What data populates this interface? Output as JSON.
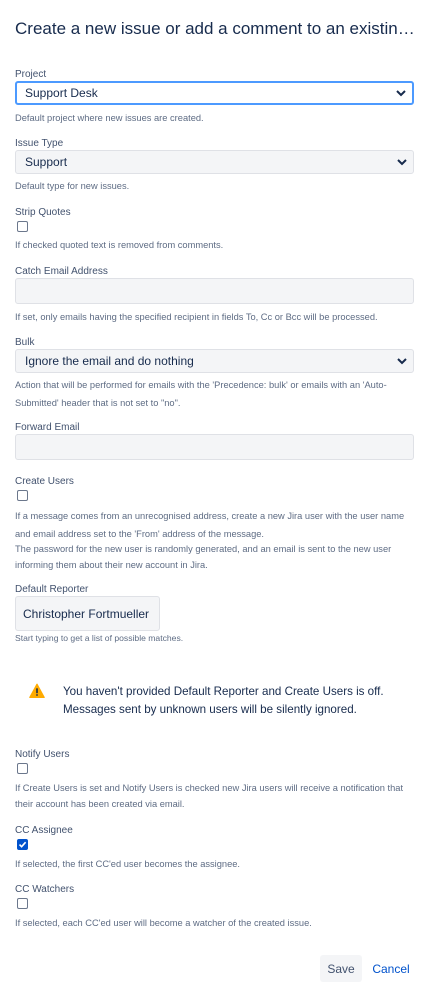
{
  "title": "Create a new issue or add a comment to an existing iss...",
  "project": {
    "label": "Project",
    "value": "Support Desk",
    "description": "Default project where new issues are created."
  },
  "issue_type": {
    "label": "Issue Type",
    "value": "Support",
    "description": "Default type for new issues."
  },
  "strip_quotes": {
    "label": "Strip Quotes",
    "checked": false,
    "description": "If checked quoted text is removed from comments."
  },
  "catch_email": {
    "label": "Catch Email Address",
    "value": "",
    "description": "If set, only emails having the specified recipient in fields To, Cc or Bcc will be processed."
  },
  "bulk": {
    "label": "Bulk",
    "value": "Ignore the email and do nothing",
    "description_line1": "Action that will be performed for emails with the 'Precedence: bulk' or emails with an 'Auto-",
    "description_line2": "Submitted' header that is not set to \"no\"."
  },
  "forward_email": {
    "label": "Forward Email",
    "value": ""
  },
  "create_users": {
    "label": "Create Users",
    "checked": false,
    "description_line1": "If a message comes from an unrecognised address, create a new Jira user with the user name",
    "description_line2": "and email address set to the 'From' address of the message.",
    "description_line3": "The password for the new user is randomly generated, and an email is sent to the new user",
    "description_line4": "informing them about their new account in Jira."
  },
  "default_reporter": {
    "label": "Default Reporter",
    "value": "Christopher Fortmueller",
    "hint": "Start typing to get a list of possible matches."
  },
  "warning": {
    "line1": "You haven't provided Default Reporter and Create Users is off.",
    "line2": "Messages sent by unknown users will be silently ignored.",
    "icon_color": "#ffab00"
  },
  "notify_users": {
    "label": "Notify Users",
    "checked": false,
    "description_line1": "If Create Users is set and Notify Users is checked new Jira users will receive a notification that",
    "description_line2": "their account has been created via email."
  },
  "cc_assignee": {
    "label": "CC Assignee",
    "checked": true,
    "description": "If selected, the first CC'ed user becomes the assignee."
  },
  "cc_watchers": {
    "label": "CC Watchers",
    "checked": false,
    "description": "If selected, each CC'ed user will become a watcher of the created issue."
  },
  "actions": {
    "save_label": "Save",
    "cancel_label": "Cancel"
  },
  "colors": {
    "primary": "#0052cc",
    "focus_border": "#4c9aff",
    "field_bg": "#f4f5f7"
  }
}
